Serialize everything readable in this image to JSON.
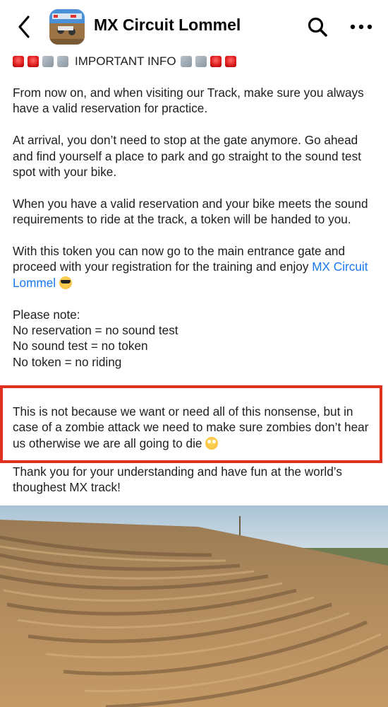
{
  "header": {
    "title": "MX Circuit Lommel",
    "back_icon": "chevron-left-icon",
    "search_icon": "search-icon",
    "more_icon": "more-horizontal-icon"
  },
  "post": {
    "important_info": "IMPORTANT INFO",
    "paragraphs": [
      "From now on, and when visiting our Track, make sure you always have a valid reservation for practice.",
      "At arrival, you don’t need to stop at the gate anymore. Go ahead and find yourself a place to park and go straight to the sound test spot with your bike.",
      "When you have a valid reservation and your bike meets the sound requirements to ride at the track, a token will be handed to you."
    ],
    "token_paragraph": "With this token you can now go to the main entrance gate and proceed with your registration for the training and enjoy",
    "link_text": "MX Circuit Lommel",
    "note_heading": "Please note:",
    "note_lines": [
      "No reservation = no sound test",
      "No sound test = no token",
      "No token = no riding"
    ],
    "highlighted": "This is not because we want or need all of this nonsense, but in case of a zombie attack we need to make sure zombies don’t hear us otherwise we are all going to die",
    "closing": "Thank you for your understanding and have fun at the world’s thoughest MX track!"
  },
  "colors": {
    "link": "#1877f2",
    "highlight_border": "#e0301e",
    "text": "#1c1e21"
  }
}
